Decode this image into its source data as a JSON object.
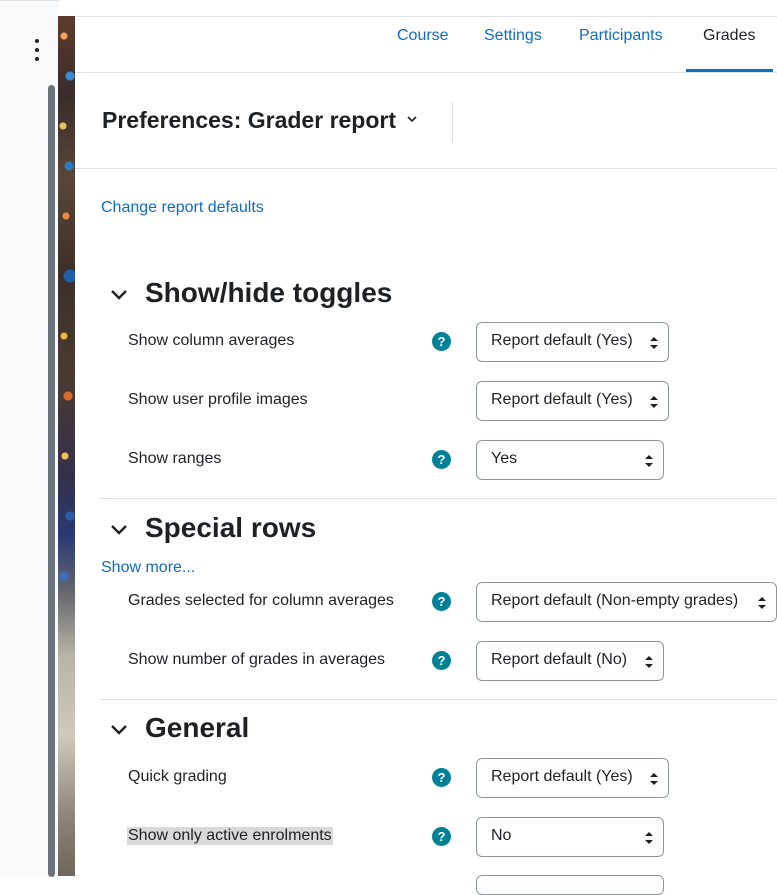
{
  "tabs": [
    {
      "label": "Course"
    },
    {
      "label": "Settings"
    },
    {
      "label": "Participants"
    },
    {
      "label": "Grades",
      "active": true
    }
  ],
  "header": {
    "title": "Preferences: Grader report"
  },
  "links": {
    "change_defaults": "Change report defaults",
    "show_more": "Show more..."
  },
  "sections": {
    "toggles": {
      "title": "Show/hide toggles",
      "rows": [
        {
          "label": "Show column averages",
          "value": "Report default (Yes)"
        },
        {
          "label": "Show user profile images",
          "value": "Report default (Yes)"
        },
        {
          "label": "Show ranges",
          "value": "Yes"
        }
      ]
    },
    "special": {
      "title": "Special rows",
      "rows": [
        {
          "label": "Grades selected for column averages",
          "value": "Report default (Non-empty grades)"
        },
        {
          "label": "Show number of grades in averages",
          "value": "Report default (No)"
        }
      ]
    },
    "general": {
      "title": "General",
      "rows": [
        {
          "label": "Quick grading",
          "value": "Report default (Yes)"
        },
        {
          "label": "Show only active enrolments",
          "value": "No"
        }
      ]
    }
  },
  "icons": {
    "help": "?"
  },
  "colors": {
    "link": "#0f6cbf",
    "help_icon": "#008196",
    "active_tab_underline": "#0f6cbf"
  }
}
